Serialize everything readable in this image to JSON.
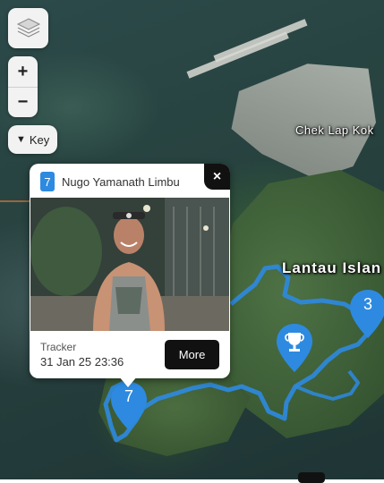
{
  "map": {
    "labels": {
      "chek_lap_kok": "Chek Lap Kok",
      "lantau": "Lantau Islan"
    },
    "route_color": "#2d8ae0"
  },
  "controls": {
    "layers_icon": "layers-icon",
    "zoom_in": "+",
    "zoom_out": "−",
    "key_arrow": "▼",
    "key_label": "Key"
  },
  "popup": {
    "badge": "7",
    "name": "Nugo Yamanath Limbu",
    "close": "×",
    "tracker_label": "Tracker",
    "tracker_time": "31 Jan 25 23:36",
    "more": "More"
  },
  "markers": {
    "runner_7": "7",
    "runner_3": "3",
    "finish_icon": "trophy-icon"
  },
  "colors": {
    "marker": "#2d8ae0",
    "popup_button": "#111111"
  }
}
